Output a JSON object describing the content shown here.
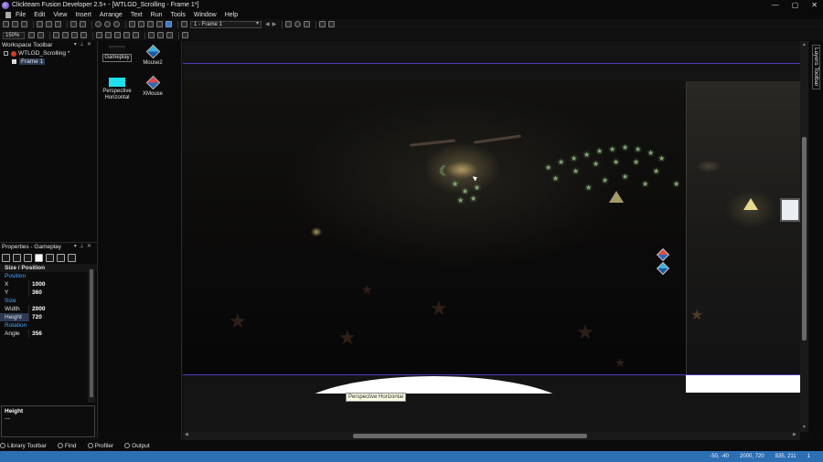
{
  "window": {
    "title": "Clickteam Fusion Developer 2.5+ - [WTLGD_Scrolling - Frame 1*]",
    "min": "—",
    "max": "▢",
    "close": "✕"
  },
  "menu": [
    "File",
    "Edit",
    "View",
    "Insert",
    "Arrange",
    "Text",
    "Run",
    "Tools",
    "Window",
    "Help"
  ],
  "toolbar": {
    "frame_select": "1 - Frame 1",
    "zoom": "150%"
  },
  "workspace": {
    "title": "Workspace Toolbar",
    "app_name": "WTLGD_Scrolling *",
    "frame_name": "Frame 1"
  },
  "objects": [
    {
      "label": "Gameplay",
      "thumb": "black-bar"
    },
    {
      "label": "Mouse2",
      "thumb": "diamond-icon"
    },
    {
      "label": "Perspective Horizontal",
      "thumb": "cyan-rect"
    },
    {
      "label": "XMouse",
      "thumb": "diamond-red-icon"
    }
  ],
  "canvas": {
    "tooltip": "Perspective Horizontal"
  },
  "layers": {
    "title": "Layers Toolbar"
  },
  "properties": {
    "title": "Properties - Gameplay",
    "section": "Size / Position",
    "position_label": "Position",
    "x_label": "X",
    "x_value": "1000",
    "y_label": "Y",
    "y_value": "360",
    "size_label": "Size",
    "width_label": "Width",
    "width_value": "2000",
    "height_label": "Height",
    "height_value": "720",
    "rotation_label": "Rotation",
    "angle_label": "Angle",
    "angle_value": "356",
    "help_title": "Height",
    "help_text": "—"
  },
  "bottom_tabs": [
    "Library Toolbar",
    "Find",
    "Profiler",
    "Output"
  ],
  "status": {
    "pos": "-50, -40",
    "size": "2000, 720",
    "cursor": "835, 211",
    "extra": "1"
  },
  "colors": {
    "frame_border": "#4b3dbd",
    "status_bar": "#2d6fb3",
    "accent_blue": "#4aa8ff"
  }
}
